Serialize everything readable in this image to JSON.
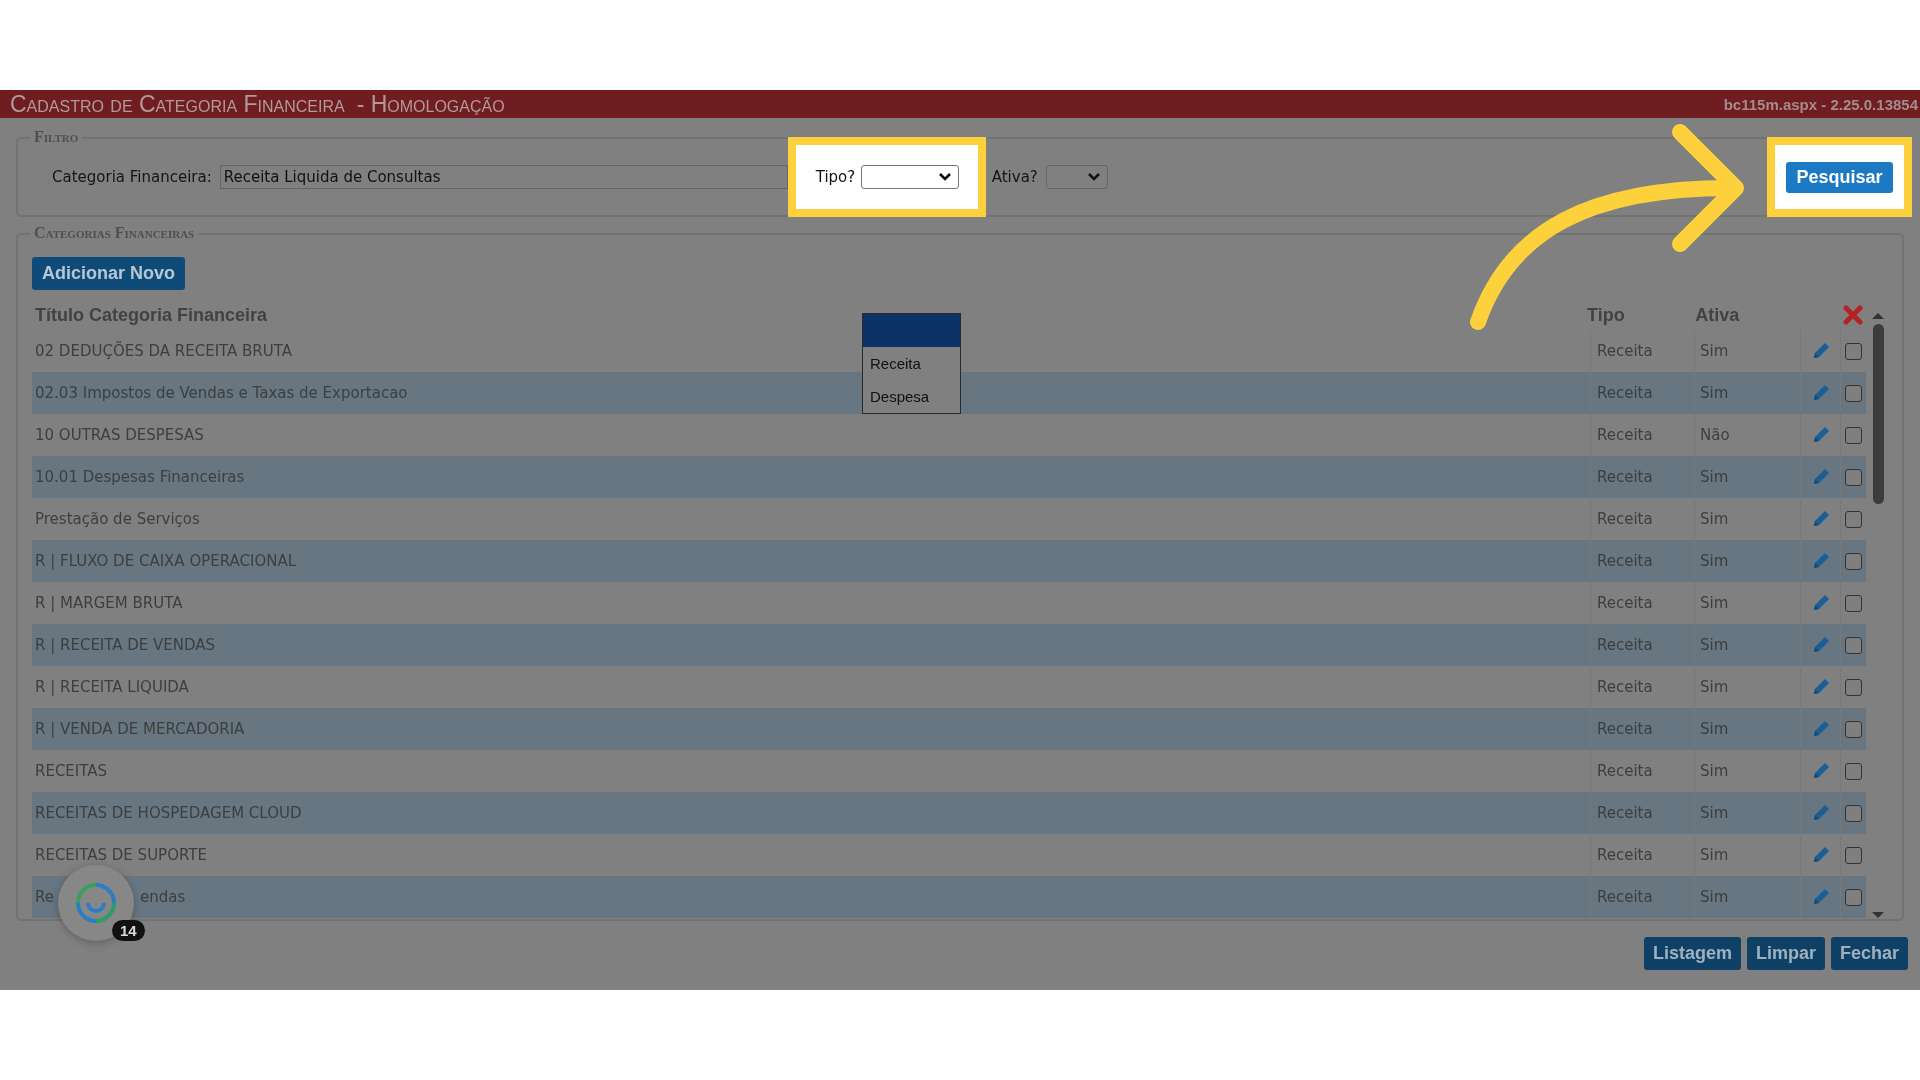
{
  "header": {
    "title": "Cadastro de Categoria Financeira",
    "environment": "- Homologação",
    "version": "bc115m.aspx - 2.25.0.13854"
  },
  "filter": {
    "legend": "Filtro",
    "category_label": "Categoria Financeira:",
    "category_value": "Receita Liquida de Consultas",
    "tipo_label": "Tipo?",
    "ativa_label": "Ativa?",
    "search_button": "Pesquisar"
  },
  "tipo_dropdown": {
    "options": [
      {
        "label": "Receita",
        "selected": false
      },
      {
        "label": "Despesa",
        "selected": false
      }
    ]
  },
  "categories": {
    "legend": "Categorias Financeiras",
    "add_button": "Adicionar Novo",
    "columns": [
      "Título Categoria Financeira",
      "Tipo",
      "Ativa"
    ],
    "rows": [
      {
        "title": "02 DEDUÇÕES DA RECEITA BRUTA",
        "tipo": "Receita",
        "ativa": "Sim",
        "checked": false
      },
      {
        "title": "02.03 Impostos de Vendas e Taxas de Exportacao",
        "tipo": "Receita",
        "ativa": "Sim",
        "checked": false
      },
      {
        "title": "10 OUTRAS DESPESAS",
        "tipo": "Receita",
        "ativa": "Não",
        "checked": false
      },
      {
        "title": "10.01 Despesas Financeiras",
        "tipo": "Receita",
        "ativa": "Sim",
        "checked": false
      },
      {
        "title": "Prestação de Serviços",
        "tipo": "Receita",
        "ativa": "Sim",
        "checked": false
      },
      {
        "title": "R | FLUXO DE CAIXA OPERACIONAL",
        "tipo": "Receita",
        "ativa": "Sim",
        "checked": false
      },
      {
        "title": "R | MARGEM BRUTA",
        "tipo": "Receita",
        "ativa": "Sim",
        "checked": false
      },
      {
        "title": "R | RECEITA DE VENDAS",
        "tipo": "Receita",
        "ativa": "Sim",
        "checked": false
      },
      {
        "title": "R | RECEITA LIQUIDA",
        "tipo": "Receita",
        "ativa": "Sim",
        "checked": false
      },
      {
        "title": "R | VENDA DE MERCADORIA",
        "tipo": "Receita",
        "ativa": "Sim",
        "checked": false
      },
      {
        "title": "RECEITAS",
        "tipo": "Receita",
        "ativa": "Sim",
        "checked": false
      },
      {
        "title": "RECEITAS DE HOSPEDAGEM CLOUD",
        "tipo": "Receita",
        "ativa": "Sim",
        "checked": false
      },
      {
        "title": "RECEITAS DE SUPORTE",
        "tipo": "Receita",
        "ativa": "Sim",
        "checked": false
      },
      {
        "title_parts": [
          "Re",
          "endas"
        ],
        "tipo": "Receita",
        "ativa": "Sim",
        "checked": false
      }
    ]
  },
  "footer_buttons": [
    "Listagem",
    "Limpar",
    "Fechar"
  ],
  "chat_widget": {
    "badge": "14"
  }
}
